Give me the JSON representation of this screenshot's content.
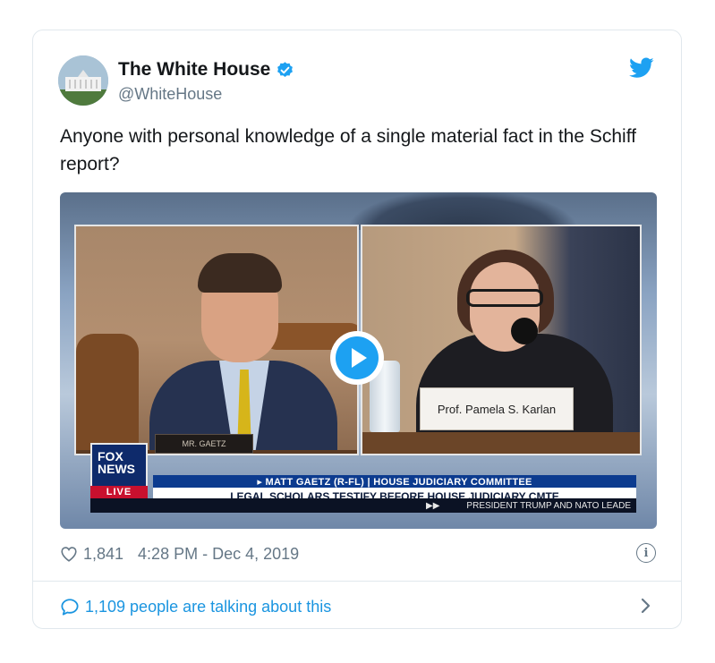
{
  "author": {
    "name": "The White House",
    "handle": "@WhiteHouse",
    "verified": true
  },
  "tweet": {
    "text": "Anyone with personal knowledge of a single material fact in the Schiff report?"
  },
  "media": {
    "type": "video",
    "left_nameplate": "MR. GAETZ",
    "right_nameplate": "Prof. Pamela S. Karlan",
    "network_logo": "FOX NEWS",
    "network_badge": "LIVE",
    "chyron_top": "▸ MATT GAETZ (R-FL) | HOUSE JUDICIARY COMMITTEE",
    "chyron_main": "LEGAL SCHOLARS TESTIFY BEFORE HOUSE JUDICIARY CMTE",
    "ticker_text": "PRESIDENT TRUMP AND NATO LEADE",
    "ticker_arrows": "▶▶"
  },
  "stats": {
    "likes": "1,841",
    "timestamp": "4:28 PM - Dec 4, 2019"
  },
  "footer": {
    "talking_text": "1,109 people are talking about this"
  },
  "colors": {
    "twitter_blue": "#1da1f2",
    "link_blue": "#1b95e0",
    "secondary_text": "#657786",
    "border": "#e1e8ed"
  },
  "icons": [
    "verified-badge-icon",
    "twitter-bird-icon",
    "play-icon",
    "heart-icon",
    "info-icon",
    "speech-bubble-icon",
    "chevron-right-icon"
  ]
}
